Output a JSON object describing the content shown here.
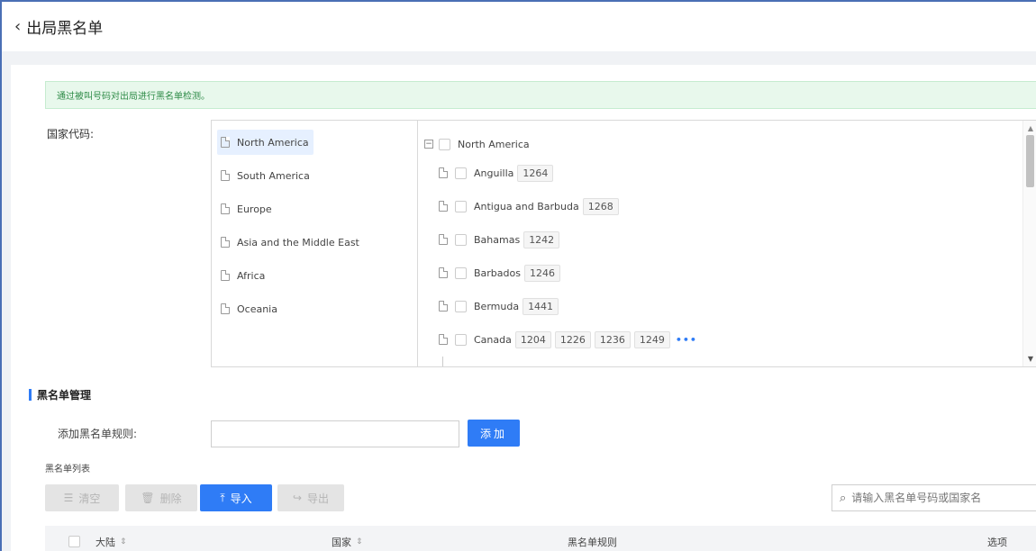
{
  "header": {
    "back_icon": "chevron-left-icon",
    "title": "出局黑名单"
  },
  "alert": {
    "text": "通过被叫号码对出局进行黑名单检测。",
    "color": "#2e8b47"
  },
  "country_code": {
    "label": "国家代码:",
    "regions": [
      {
        "label": "North America",
        "selected": true
      },
      {
        "label": "South America",
        "selected": false
      },
      {
        "label": "Europe",
        "selected": false
      },
      {
        "label": "Asia and the Middle East",
        "selected": false
      },
      {
        "label": "Africa",
        "selected": false
      },
      {
        "label": "Oceania",
        "selected": false
      }
    ],
    "root": {
      "label": "North America"
    },
    "countries": [
      {
        "name": "Anguilla",
        "codes": [
          "1264"
        ]
      },
      {
        "name": "Antigua and Barbuda",
        "codes": [
          "1268"
        ]
      },
      {
        "name": "Bahamas",
        "codes": [
          "1242"
        ]
      },
      {
        "name": "Barbados",
        "codes": [
          "1246"
        ]
      },
      {
        "name": "Bermuda",
        "codes": [
          "1441"
        ]
      },
      {
        "name": "Canada",
        "codes": [
          "1204",
          "1226",
          "1236",
          "1249"
        ],
        "more": "•••"
      }
    ]
  },
  "blacklist": {
    "section_title": "黑名单管理",
    "add_label": "添加黑名单规则:",
    "add_value": "",
    "add_button": "添加",
    "list_label": "黑名单列表",
    "toolbar": {
      "clear": "清空",
      "delete": "删除",
      "import": "导入",
      "export": "导出"
    },
    "search_placeholder": "请输入黑名单号码或国家名",
    "columns": {
      "continent": "大陆",
      "country": "国家",
      "rule": "黑名单规则",
      "options": "选项"
    }
  },
  "colors": {
    "accent": "#2f7cf6",
    "frame": "#4a6fb5"
  }
}
